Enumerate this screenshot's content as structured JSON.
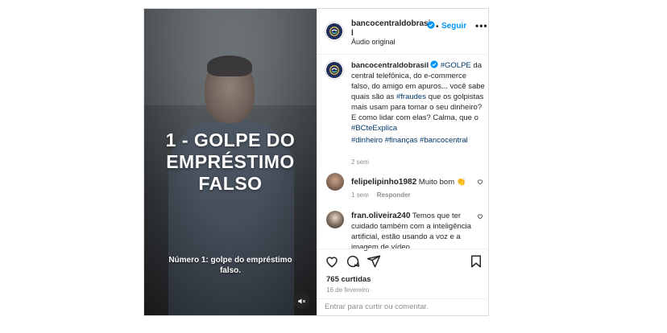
{
  "video": {
    "overlay_title": "1 - GOLPE DO EMPRÉSTIMO FALSO",
    "subtitle": "Número 1: golpe do empréstimo falso.",
    "mute_icon": "speaker-muted-icon"
  },
  "header": {
    "username": "bancocentraldobrasil",
    "separator": "•",
    "follow_label": "Seguir",
    "audio_label": "Áudio original",
    "more_icon": "more-horizontal-icon"
  },
  "post": {
    "username": "bancocentraldobrasil",
    "text_before_tag1": " ",
    "tag1": "#GOLPE",
    "text1": " da central telefônica, do e-commerce falso, do amigo em apuros... você sabe quais são as ",
    "tag2": "#fraudes",
    "text2": " que os golpistas mais usam para tomar o seu dinheiro? E como lidar com elas? Calma, que o ",
    "tag3": "#BCteExplica",
    "tags_line": "#dinheiro #finanças #bancocentral",
    "time": "2 sem"
  },
  "comments": [
    {
      "username": "felipelipinho1982",
      "text": " Muito bom 👏",
      "time": "1 sem",
      "reply": "Responder"
    },
    {
      "username": "fran.oliveira240",
      "text": " Temos que ter cuidado também com a inteligência artificial, estão usando a voz e a imagem de vídeo."
    }
  ],
  "stats": {
    "likes": "765 curtidas",
    "date": "16 de fevereiro"
  },
  "comment_box": {
    "placeholder": "Entrar para curtir ou comentar."
  },
  "colors": {
    "link_blue": "#0095f6",
    "hashtag": "#00376b",
    "verified": "#0095f6"
  }
}
